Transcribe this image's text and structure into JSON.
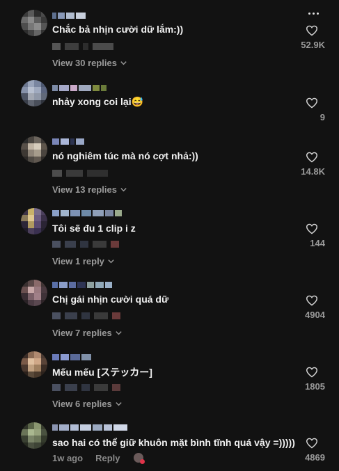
{
  "comments": [
    {
      "text": "Chắc bả nhịn cười dữ lắm:))",
      "likes": "52.9K",
      "views": "View 30 replies",
      "meta": ""
    },
    {
      "text": "nhảy xong coi lại😅",
      "likes": "9",
      "views": "",
      "meta": ""
    },
    {
      "text": "nó nghiêm túc mà nó cợt nhả:))",
      "likes": "14.8K",
      "views": "View 13 replies",
      "meta": ""
    },
    {
      "text": "Tôi sẽ đu 1 clip i z",
      "likes": "144",
      "views": "View 1 reply",
      "meta": ""
    },
    {
      "text": "Chị gái nhịn cười quá dữ",
      "likes": "4904",
      "views": "View 7 replies",
      "meta": ""
    },
    {
      "text": "Mếu mếu [ステッカー]",
      "likes": "1805",
      "views": "View 6 replies",
      "meta": ""
    },
    {
      "text": "sao hai có thể giữ khuôn mặt bình tĩnh quá vậy =)))))",
      "likes": "4869",
      "views": "",
      "meta": "1w ago",
      "reply": "Reply"
    }
  ],
  "icons": {
    "like": "heart-outline-icon",
    "more": "more-dots-icon",
    "expand": "chevron-down-icon"
  },
  "colors": {
    "background": "#121212",
    "text": "#f1f1f1",
    "muted": "#9a9a9a"
  }
}
